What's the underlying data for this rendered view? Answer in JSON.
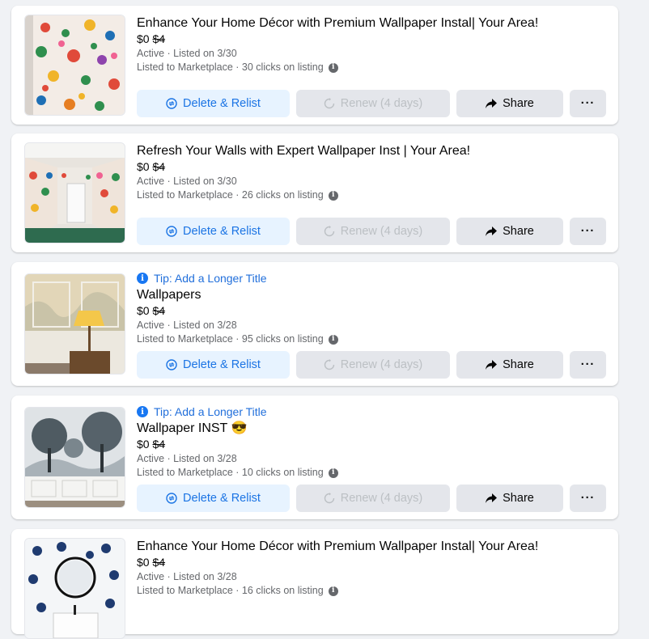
{
  "listings": [
    {
      "tip": "",
      "title": "Enhance Your Home Décor with Premium Wallpaper Instal| Your Area!",
      "price": "$0",
      "old_price": "$4",
      "status": "Active · Listed on 3/30",
      "clicks": "Listed to Marketplace · 30 clicks on listing",
      "thumb": "floral-room"
    },
    {
      "tip": "",
      "title": "Refresh Your Walls with Expert Wallpaper Inst | Your Area!",
      "price": "$0",
      "old_price": "$4",
      "status": "Active · Listed on 3/30",
      "clicks": "Listed to Marketplace · 26 clicks on listing",
      "thumb": "floral-hall"
    },
    {
      "tip": "Tip: Add a Longer Title",
      "title": "Wallpapers",
      "price": "$0",
      "old_price": "$4",
      "status": "Active · Listed on 3/28",
      "clicks": "Listed to Marketplace · 95 clicks on listing",
      "thumb": "lamp-room"
    },
    {
      "tip": "Tip: Add a Longer Title",
      "title": "Wallpaper INST",
      "title_emoji": "😎",
      "price": "$0",
      "old_price": "$4",
      "status": "Active · Listed on 3/28",
      "clicks": "Listed to Marketplace · 10 clicks on listing",
      "thumb": "tree-mural"
    },
    {
      "tip": "",
      "title": "Enhance Your Home Décor with Premium Wallpaper Instal| Your Area!",
      "price": "$0",
      "old_price": "$4",
      "status": "Active · Listed on 3/28",
      "clicks": "Listed to Marketplace · 16 clicks on listing",
      "thumb": "bath-mirror"
    }
  ],
  "buttons": {
    "relist": "Delete & Relist",
    "renew": "Renew (4 days)",
    "share": "Share",
    "more": "···"
  },
  "icons": {
    "info": "i",
    "relist": "relist-icon",
    "renew": "renew-icon",
    "share": "share-icon"
  },
  "colors": {
    "page_bg": "#f0f2f5",
    "link_blue": "#216fdb",
    "relist_bg": "#e7f3ff",
    "secondary_text": "#65676b"
  }
}
